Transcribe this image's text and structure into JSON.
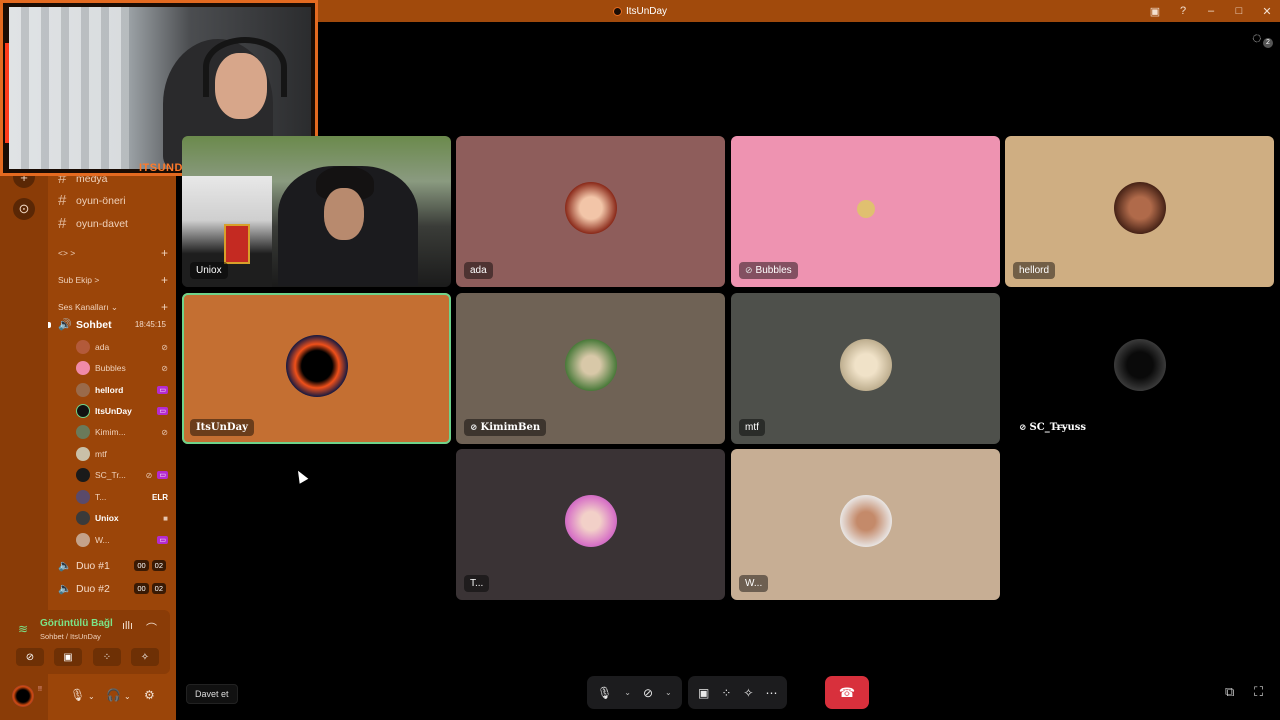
{
  "window": {
    "title": "ItsUnDay"
  },
  "titlebar_icons": [
    "inbox-icon",
    "help-icon",
    "minimize-icon",
    "maximize-icon",
    "close-icon"
  ],
  "sidebar": {
    "channels": [
      {
        "name": "medya"
      },
      {
        "name": "oyun-öneri"
      },
      {
        "name": "oyun-davet"
      }
    ],
    "categories": [
      {
        "label": "<> >"
      },
      {
        "label": "Sub Ekip >"
      },
      {
        "label": "Ses Kanalları ⌄"
      }
    ],
    "voice_channel": {
      "name": "Sohbet",
      "time": "18:45:15"
    },
    "members": [
      {
        "name": "ada",
        "bold": false,
        "avatar_color": "#b35a3a",
        "status": "⊘"
      },
      {
        "name": "Bubbles",
        "bold": false,
        "avatar_color": "#f08aa8",
        "status": "⊘̸"
      },
      {
        "name": "hellord",
        "bold": true,
        "avatar_color": "#9a6a4a",
        "status": "🛡"
      },
      {
        "name": "ItsUnDay",
        "bold": true,
        "avatar_color": "#111111",
        "status": ""
      },
      {
        "name": "Kimim...",
        "bold": false,
        "avatar_color": "#6a7a5a",
        "status": "⊘̸"
      },
      {
        "name": "mtf",
        "bold": false,
        "avatar_color": "#c9c0a8",
        "status": ""
      },
      {
        "name": "SC_Tr...",
        "bold": false,
        "avatar_color": "#1a1a1a",
        "status": "⊘̸"
      },
      {
        "name": "T...",
        "bold": false,
        "avatar_color": "#5a4a6a",
        "status": "ELR"
      },
      {
        "name": "Uniox",
        "bold": true,
        "avatar_color": "#3a3a3a",
        "status": "■"
      },
      {
        "name": "W...",
        "bold": false,
        "avatar_color": "#c4a28a",
        "status": ""
      }
    ],
    "other_voice": [
      {
        "name": "Duo #1",
        "a": "00",
        "b": "02"
      },
      {
        "name": "Duo #2",
        "a": "00",
        "b": "02"
      }
    ]
  },
  "voice_panel": {
    "status": "Görüntülü Bağl",
    "location": "Sohbet / ItsUnDay"
  },
  "user": {
    "name": "!!"
  },
  "webcam": {
    "brand": "ITSUNDAY"
  },
  "tiles": [
    {
      "name": "Uniox",
      "bg": "video",
      "muted": false
    },
    {
      "name": "ada",
      "bg": "#8e5d5b",
      "avatar": "#c0403a",
      "muted": false
    },
    {
      "name": "Bubbles",
      "bg": "#ee93b1",
      "avatar": "#ee93b1",
      "muted": true
    },
    {
      "name": "hellord",
      "bg": "#cfae82",
      "avatar": "#7a4a3a",
      "muted": false
    },
    {
      "name": "ItsUnDay",
      "bg": "#c46f32",
      "avatar": "#111111",
      "muted": false,
      "active": true,
      "fancy": true
    },
    {
      "name": "KimimBen",
      "bg": "#6f6255",
      "avatar": "#4a6a3a",
      "muted": true,
      "fancy": true
    },
    {
      "name": "mtf",
      "bg": "#4e504b",
      "avatar": "#d8d0b8",
      "muted": false
    },
    {
      "name": "SC_Tr̶y̶uss",
      "bg": "#000000",
      "avatar": "#2a2a2a",
      "muted": true,
      "fancy": true
    },
    {
      "name": "T...",
      "bg": "#3a3335",
      "avatar": "#d875c6",
      "muted": false
    },
    {
      "name": "W...",
      "bg": "#c7ae94",
      "avatar": "#e0d6d0",
      "muted": false
    }
  ],
  "invite_tooltip": "Davet et",
  "threads_badge": "2"
}
